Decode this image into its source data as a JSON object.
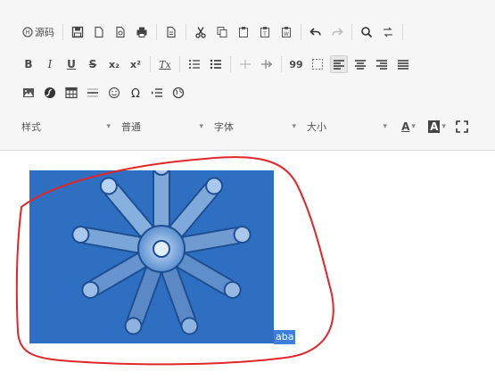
{
  "toolbar": {
    "row1": {
      "source_label": "源码",
      "icons": [
        "save-icon",
        "new-document-icon",
        "preview-icon",
        "print-icon",
        "template-icon",
        "cut-icon",
        "copy-icon",
        "paste-icon",
        "paste-text-icon",
        "paste-word-icon",
        "undo-icon",
        "redo-icon",
        "find-icon",
        "replace-icon"
      ]
    },
    "row2": {
      "bold": "B",
      "italic": "I",
      "underline": "U",
      "strike": "S",
      "subscript": "x₂",
      "superscript": "x²",
      "remove_format": "Tx",
      "blockquote": "99"
    },
    "format_combos": {
      "style": "样式",
      "format": "普通",
      "font": "字体",
      "size": "大小"
    },
    "text_color_label": "A",
    "bg_color_label": "A"
  },
  "editor": {
    "selected_text": "aba"
  },
  "colors": {
    "toolbar_bg": "#f6f6f6",
    "image_blue": "#2e6fc3",
    "selection": "#3d7fd9",
    "annotation": "#e0262b"
  }
}
